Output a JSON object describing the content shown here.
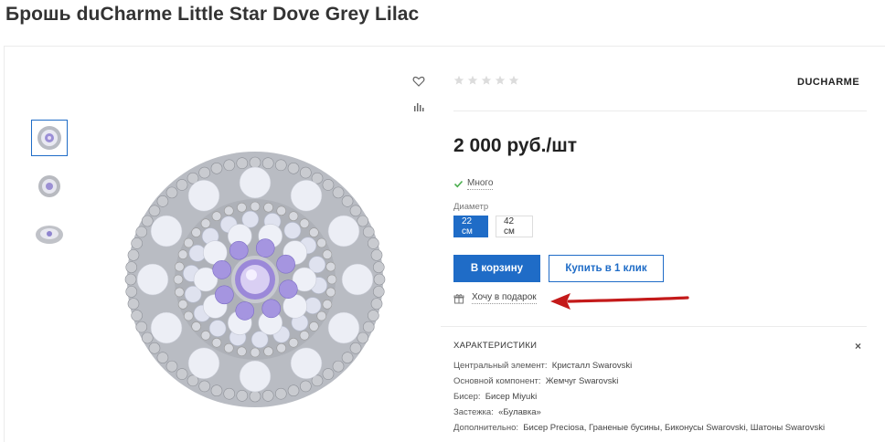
{
  "product": {
    "title": "Брошь duCharme Little Star Dove Grey Lilac",
    "brand": "DUCHARME",
    "price": "2 000 руб./шт",
    "rating": 0,
    "rating_max": 5,
    "stock_label": "Много"
  },
  "options": {
    "label": "Диаметр",
    "values": [
      "22 см",
      "42 см"
    ],
    "selected": "22 см"
  },
  "actions": {
    "add_to_cart": "В корзину",
    "buy_one_click": "Купить в 1 клик",
    "gift": "Хочу в подарок"
  },
  "specs": {
    "title": "ХАРАКТЕРИСТИКИ",
    "close": "×",
    "rows": [
      {
        "key": "Центральный элемент:",
        "value": "Кристалл Swarovski"
      },
      {
        "key": "Основной компонент:",
        "value": "Жемчуг Swarovski"
      },
      {
        "key": "Бисер:",
        "value": "Бисер Miyuki"
      },
      {
        "key": "Застежка:",
        "value": "«Булавка»"
      },
      {
        "key": "Дополнительно:",
        "value": "Бисер Preciosa, Граненые бусины, Биконусы Swarovski, Шатоны Swarovski"
      }
    ]
  },
  "icons": {
    "favorite": "heart-icon",
    "compare": "bar-chart-icon",
    "stock": "check-icon",
    "gift": "gift-icon"
  },
  "colors": {
    "accent": "#1f6cc7",
    "arrow": "#c41a1a",
    "check": "#4caf50"
  }
}
